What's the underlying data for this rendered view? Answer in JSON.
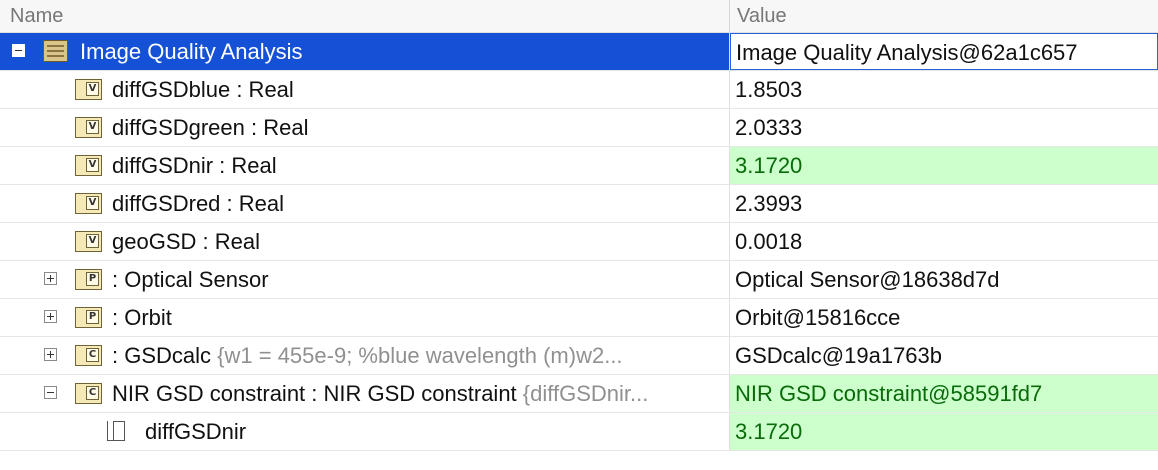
{
  "header": {
    "name_label": "Name",
    "value_label": "Value"
  },
  "icons": {
    "collapse": "minus-box-icon",
    "expand": "plus-box-icon",
    "package": "package-icon",
    "value_property": "v-badge-icon",
    "part_property": "p-badge-icon",
    "constraint": "c-badge-icon",
    "parameter": "document-icon"
  },
  "colors": {
    "selection": "#1551d6",
    "changed_value_bg": "#ccffcc",
    "changed_value_text": "#0a6a0a"
  },
  "rows": [
    {
      "name": "Image Quality Analysis",
      "detail": "",
      "value": "Image Quality Analysis@62a1c657",
      "selected": true,
      "icon": "package-icon",
      "expander": "collapse"
    },
    {
      "name": "diffGSDblue : Real",
      "detail": "",
      "value": "1.8503",
      "icon": "v-badge-icon"
    },
    {
      "name": "diffGSDgreen : Real",
      "detail": "",
      "value": "2.0333",
      "icon": "v-badge-icon"
    },
    {
      "name": "diffGSDnir : Real",
      "detail": "",
      "value": "3.1720",
      "highlighted": true,
      "icon": "v-badge-icon"
    },
    {
      "name": "diffGSDred : Real",
      "detail": "",
      "value": "2.3993",
      "icon": "v-badge-icon"
    },
    {
      "name": "geoGSD : Real",
      "detail": "",
      "value": "0.0018",
      "icon": "v-badge-icon"
    },
    {
      "name": " : Optical Sensor",
      "detail": "",
      "value": "Optical Sensor@18638d7d",
      "icon": "p-badge-icon",
      "expander": "expand"
    },
    {
      "name": " : Orbit",
      "detail": "",
      "value": "Orbit@15816cce",
      "icon": "p-badge-icon",
      "expander": "expand"
    },
    {
      "name": " : GSDcalc",
      "detail": "{w1 = 455e-9; %blue wavelength (m)w2...",
      "value": "GSDcalc@19a1763b",
      "icon": "c-badge-icon",
      "expander": "expand"
    },
    {
      "name": "NIR GSD constraint : NIR GSD constraint",
      "detail": "{diffGSDnir...",
      "value": "NIR GSD constraint@58591fd7",
      "highlighted": true,
      "icon": "c-badge-icon",
      "expander": "collapse"
    },
    {
      "name": "diffGSDnir",
      "detail": "",
      "value": "3.1720",
      "highlighted": true,
      "icon": "document-icon"
    }
  ]
}
